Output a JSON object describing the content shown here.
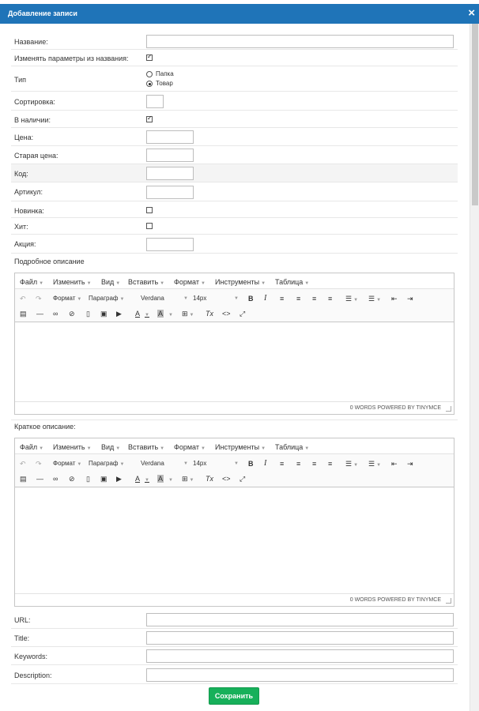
{
  "dialog": {
    "title": "Добавление записи",
    "close_icon": "×"
  },
  "fields": {
    "name_label": "Название:",
    "change_params_label": "Изменять параметры из названия:",
    "type_label": "Тип",
    "type_options": [
      "Папка",
      "Товар"
    ],
    "type_selected": "Товар",
    "sort_label": "Сортировка:",
    "in_stock_label": "В наличии:",
    "price_label": "Цена:",
    "old_price_label": "Старая цена:",
    "code_label": "Код:",
    "article_label": "Артикул:",
    "new_label": "Новинка:",
    "hit_label": "Хит:",
    "promo_label": "Акция:",
    "url_label": "URL:",
    "title_label": "Title:",
    "keywords_label": "Keywords:",
    "description_label": "Description:"
  },
  "checkbox_states": {
    "change_params": true,
    "in_stock": true,
    "new": false,
    "hit": false
  },
  "editor_labels": {
    "full_description": "Подробное описание",
    "short_description": "Краткое описание:"
  },
  "editor": {
    "menus": [
      "Файл",
      "Изменить",
      "Вид",
      "Вставить",
      "Формат",
      "Инструменты",
      "Таблица"
    ],
    "toolbar": {
      "undo_icon": "↶",
      "redo_icon": "↷",
      "format_dd": "Формат",
      "paragraph_dd": "Параграф",
      "font_dd": "Verdana",
      "size_dd": "14px",
      "bold_icon": "B",
      "italic_icon": "I",
      "align_left_icon": "≡",
      "align_center_icon": "≡",
      "align_right_icon": "≡",
      "align_justify_icon": "≡",
      "bullet_list_icon": "☰",
      "numbered_list_icon": "☰",
      "outdent_icon": "⇤",
      "indent_icon": "⇥",
      "paste_icon": "▤",
      "hr_icon": "—",
      "link_icon": "∞",
      "unlink_icon": "⊘",
      "bookmark_icon": "▯",
      "image_icon": "▣",
      "media_icon": "▶",
      "text_color_icon": "A",
      "bg_color_icon": "A",
      "table_icon": "⊞",
      "clear_format_icon": "Tx",
      "code_icon": "<>",
      "fullscreen_icon": "⤢"
    },
    "status": "0 WORDS POWERED BY TINYMCE"
  },
  "actions": {
    "save_label": "Сохранить"
  },
  "colors": {
    "title_bar": "#1f74b8",
    "save_button": "#17b05a"
  }
}
